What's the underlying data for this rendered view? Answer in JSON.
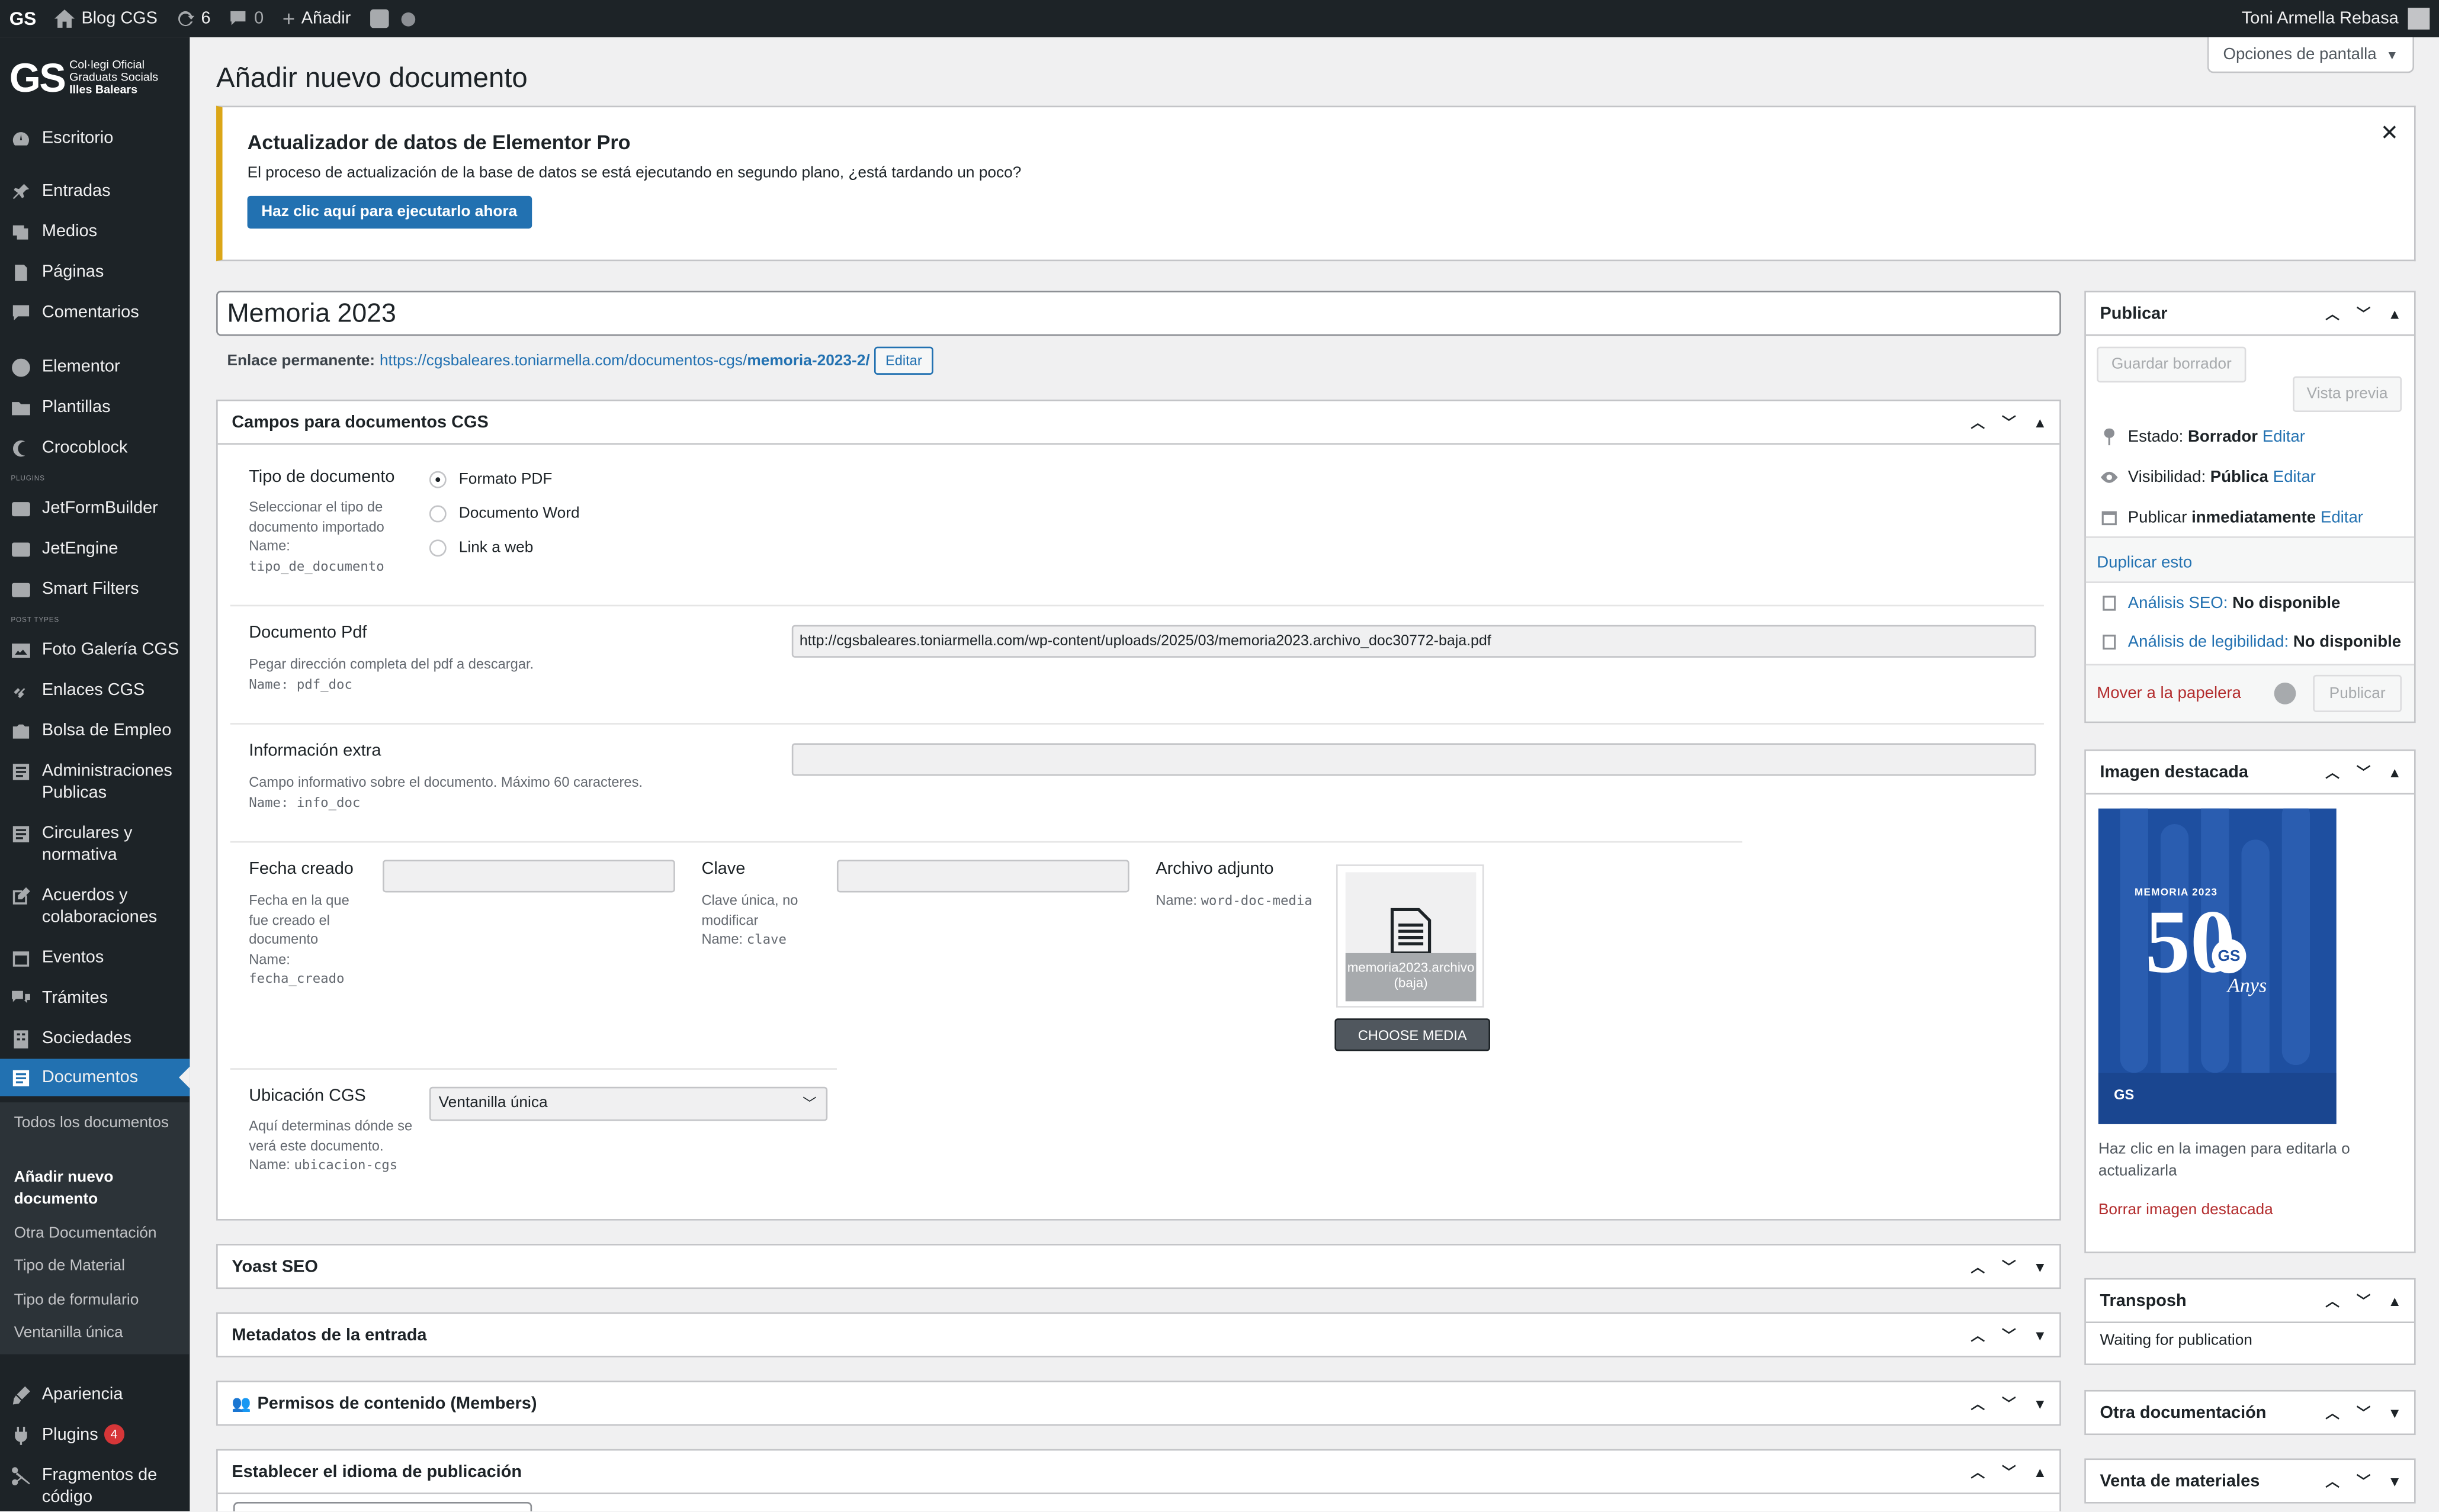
{
  "admin_bar": {
    "site_name": "Blog CGS",
    "updates": "6",
    "comments": "0",
    "add_new": "Añadir",
    "user": "Toni Armella Rebasa"
  },
  "logo": {
    "mark": "GS",
    "line1": "Col·legi Oficial",
    "line2": "Graduats Socials",
    "line3": "Illes Balears"
  },
  "menu": {
    "dashboard": "Escritorio",
    "posts": "Entradas",
    "media": "Medios",
    "pages": "Páginas",
    "comments": "Comentarios",
    "elementor": "Elementor",
    "templates": "Plantillas",
    "crocoblock": "Crocoblock",
    "sep_plugins": "PLUGINS",
    "jetformbuilder": "JetFormBuilder",
    "jetengine": "JetEngine",
    "smartfilters": "Smart Filters",
    "sep_posttypes": "POST TYPES",
    "foto": "Foto Galería CGS",
    "enlaces": "Enlaces CGS",
    "bolsa": "Bolsa de Empleo",
    "admin": "Administraciones Publicas",
    "circulares": "Circulares y normativa",
    "acuerdos": "Acuerdos y colaboraciones",
    "eventos": "Eventos",
    "tramites": "Trámites",
    "sociedades": "Sociedades",
    "documentos": "Documentos",
    "sub_todos": "Todos los documentos",
    "sub_anadir": "Añadir nuevo documento",
    "sub_otra": "Otra Documentación",
    "sub_tipo_material": "Tipo de Material",
    "sub_tipo_form": "Tipo de formulario",
    "sub_ventanilla": "Ventanilla única",
    "apariencia": "Apariencia",
    "plugins": "Plugins",
    "plugins_count": "4",
    "fragmentos": "Fragmentos de código"
  },
  "page": {
    "title": "Añadir nuevo documento",
    "screen_options": "Opciones de pantalla"
  },
  "notice": {
    "title": "Actualizador de datos de Elementor Pro",
    "text": "El proceso de actualización de la base de datos se está ejecutando en segundo plano, ¿está tardando un poco?",
    "button": "Haz clic aquí para ejecutarlo ahora"
  },
  "post": {
    "title": "Memoria 2023",
    "permalink_label": "Enlace permanente:",
    "permalink_base": "https://cgsbaleares.toniarmella.com/documentos-cgs/",
    "permalink_slug": "memoria-2023-2/",
    "edit": "Editar"
  },
  "fields_box": {
    "title": "Campos para documentos CGS",
    "tipo_label": "Tipo de documento",
    "tipo_desc": "Seleccionar el tipo de documento importado",
    "tipo_name_prefix": "Name:",
    "tipo_name": "tipo_de_documento",
    "radio_pdf": "Formato PDF",
    "radio_word": "Documento Word",
    "radio_link": "Link a web",
    "pdf_label": "Documento Pdf",
    "pdf_desc": "Pegar dirección completa del pdf a descargar.",
    "pdf_name": "Name: pdf_doc",
    "pdf_value": "http://cgsbaleares.toniarmella.com/wp-content/uploads/2025/03/memoria2023.archivo_doc30772-baja.pdf",
    "info_label": "Información extra",
    "info_desc": "Campo informativo sobre el documento. Máximo 60 caracteres.",
    "info_name": "Name: info_doc",
    "fecha_label": "Fecha creado",
    "fecha_desc": "Fecha en la que fue creado el documento",
    "fecha_name": "fecha_creado",
    "clave_label": "Clave",
    "clave_desc": "Clave única, no modificar",
    "clave_name": "clave",
    "archivo_label": "Archivo adjunto",
    "archivo_name": "word-doc-media",
    "file_name": "memoria2023.archivo",
    "file_sub": "(baja)",
    "choose": "CHOOSE MEDIA",
    "ubic_label": "Ubicación CGS",
    "ubic_desc": "Aquí determinas dónde se verá este documento.",
    "ubic_name": "ubicacion-cgs",
    "ubic_value": "Ventanilla única"
  },
  "boxes": {
    "yoast": "Yoast SEO",
    "meta": "Metadatos de la entrada",
    "permisos": "Permisos de contenido (Members)",
    "idioma": "Establecer el idioma de publicación"
  },
  "publish": {
    "title": "Publicar",
    "save_draft": "Guardar borrador",
    "preview": "Vista previa",
    "status_label": "Estado:",
    "status_value": "Borrador",
    "visibility_label": "Visibilidad:",
    "visibility_value": "Pública",
    "publish_label": "Publicar",
    "publish_value": "inmediatamente",
    "edit": "Editar",
    "duplicate": "Duplicar esto",
    "seo_label": "Análisis SEO:",
    "seo_value": "No disponible",
    "read_label": "Análisis de legibilidad:",
    "read_value": "No disponible",
    "trash": "Mover a la papelera",
    "publish_btn": "Publicar"
  },
  "featured": {
    "title": "Imagen destacada",
    "img_title": "MEMORIA 2023",
    "img_big": "50",
    "img_anys": "Anys",
    "img_gs": "GS",
    "help": "Haz clic en la imagen para editarla o actualizarla",
    "remove": "Borrar imagen destacada"
  },
  "transposh": {
    "title": "Transposh",
    "text": "Waiting for publication"
  },
  "side_boxes": {
    "otra": "Otra documentación",
    "venta": "Venta de materiales"
  }
}
